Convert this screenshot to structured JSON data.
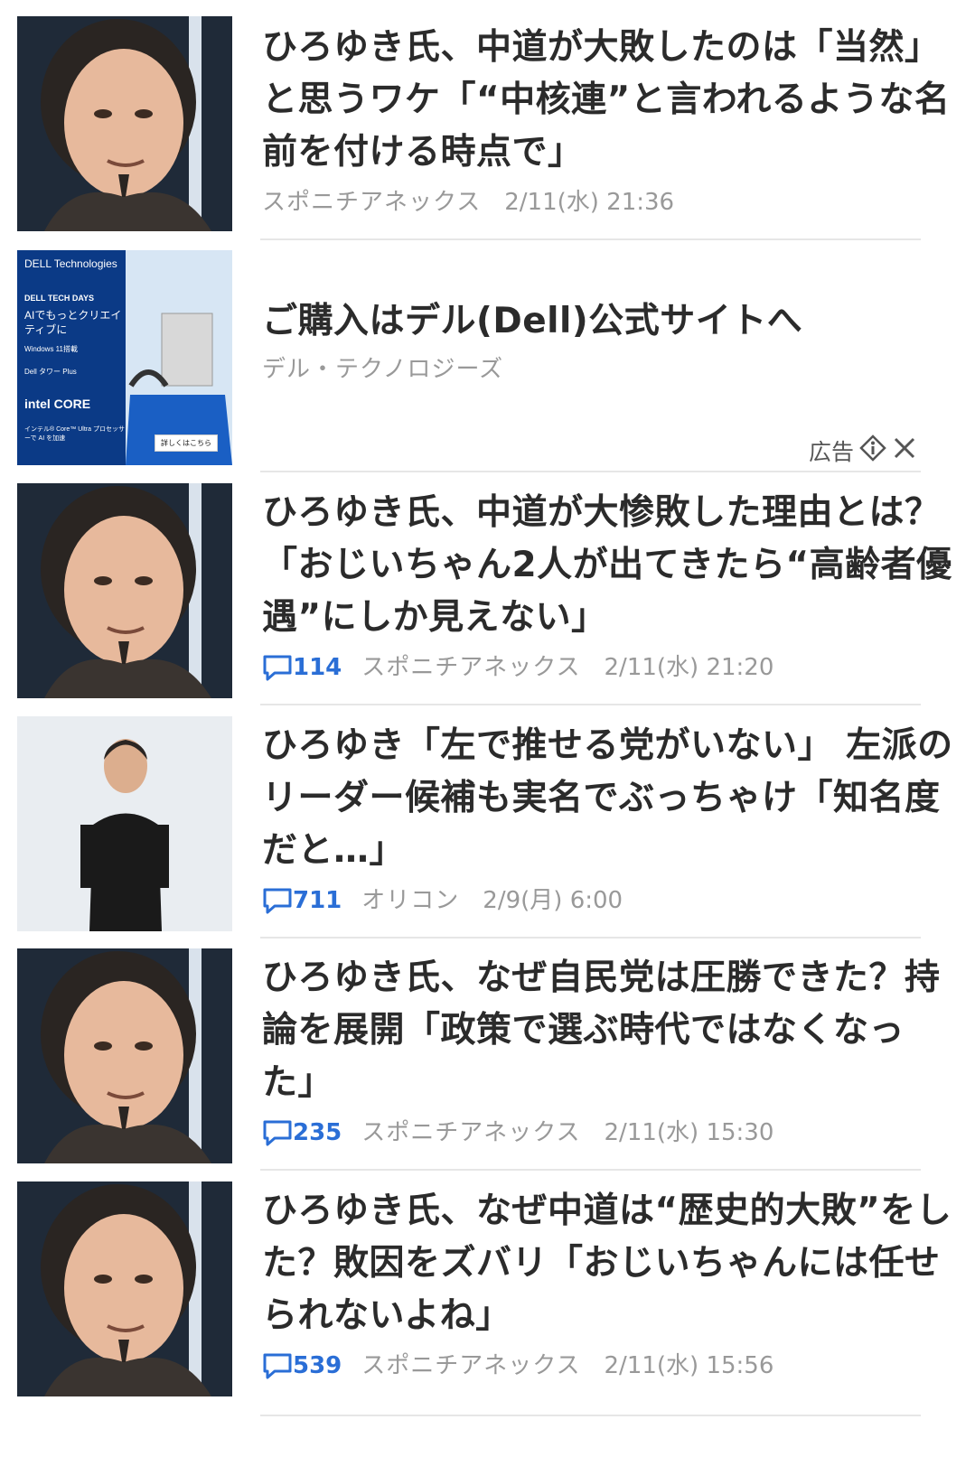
{
  "articles": [
    {
      "title": "ひろゆき氏、中道が大敗したのは「当然」と思うワケ「“中核連”と言われるような名前を付ける時点で」",
      "comments": "",
      "source": "スポニチアネックス",
      "time": "2/11(水) 21:36",
      "thumb": "portrait-hiroyuki"
    },
    {
      "title": "ひろゆき氏、中道が大惨敗した理由とは？「おじいちゃん2人が出てきたら“高齢者優遇”にしか見えない」",
      "comments": "114",
      "source": "スポニチアネックス",
      "time": "2/11(水) 21:20",
      "thumb": "portrait-hiroyuki"
    },
    {
      "title": "ひろゆき「左で推せる党がいない」 左派のリーダー候補も実名でぶっちゃけ「知名度だと…」",
      "comments": "711",
      "source": "オリコン",
      "time": "2/9(月) 6:00",
      "thumb": "standing-hiroyuki"
    },
    {
      "title": "ひろゆき氏、なぜ自民党は圧勝できた？持論を展開「政策で選ぶ時代ではなくなった」",
      "comments": "235",
      "source": "スポニチアネックス",
      "time": "2/11(水) 15:30",
      "thumb": "portrait-hiroyuki"
    },
    {
      "title": "ひろゆき氏、なぜ中道は“歴史的大敗”をした？敗因をズバリ「おじいちゃんには任せられないよね」",
      "comments": "539",
      "source": "スポニチアネックス",
      "time": "2/11(水) 15:56",
      "thumb": "portrait-hiroyuki"
    }
  ],
  "ad": {
    "title": "ご購入はデル(Dell)公式サイトへ",
    "sponsor": "デル・テクノロジーズ",
    "label": "広告",
    "banner": {
      "brand": "DELL Technologies",
      "event": "DELL TECH DAYS",
      "headline": "AIでもっとクリエイティブに",
      "os": "Windows 11搭載",
      "product": "Dell タワー Plus",
      "chip": "intel CORE",
      "chip_note": "インテル® Core™ Ultra プロセッサーで AI を加速",
      "cta": "詳しくはこちら"
    }
  },
  "colors": {
    "accent": "#2a6ed6",
    "meta": "#999999",
    "divider": "#e6e6e6"
  }
}
